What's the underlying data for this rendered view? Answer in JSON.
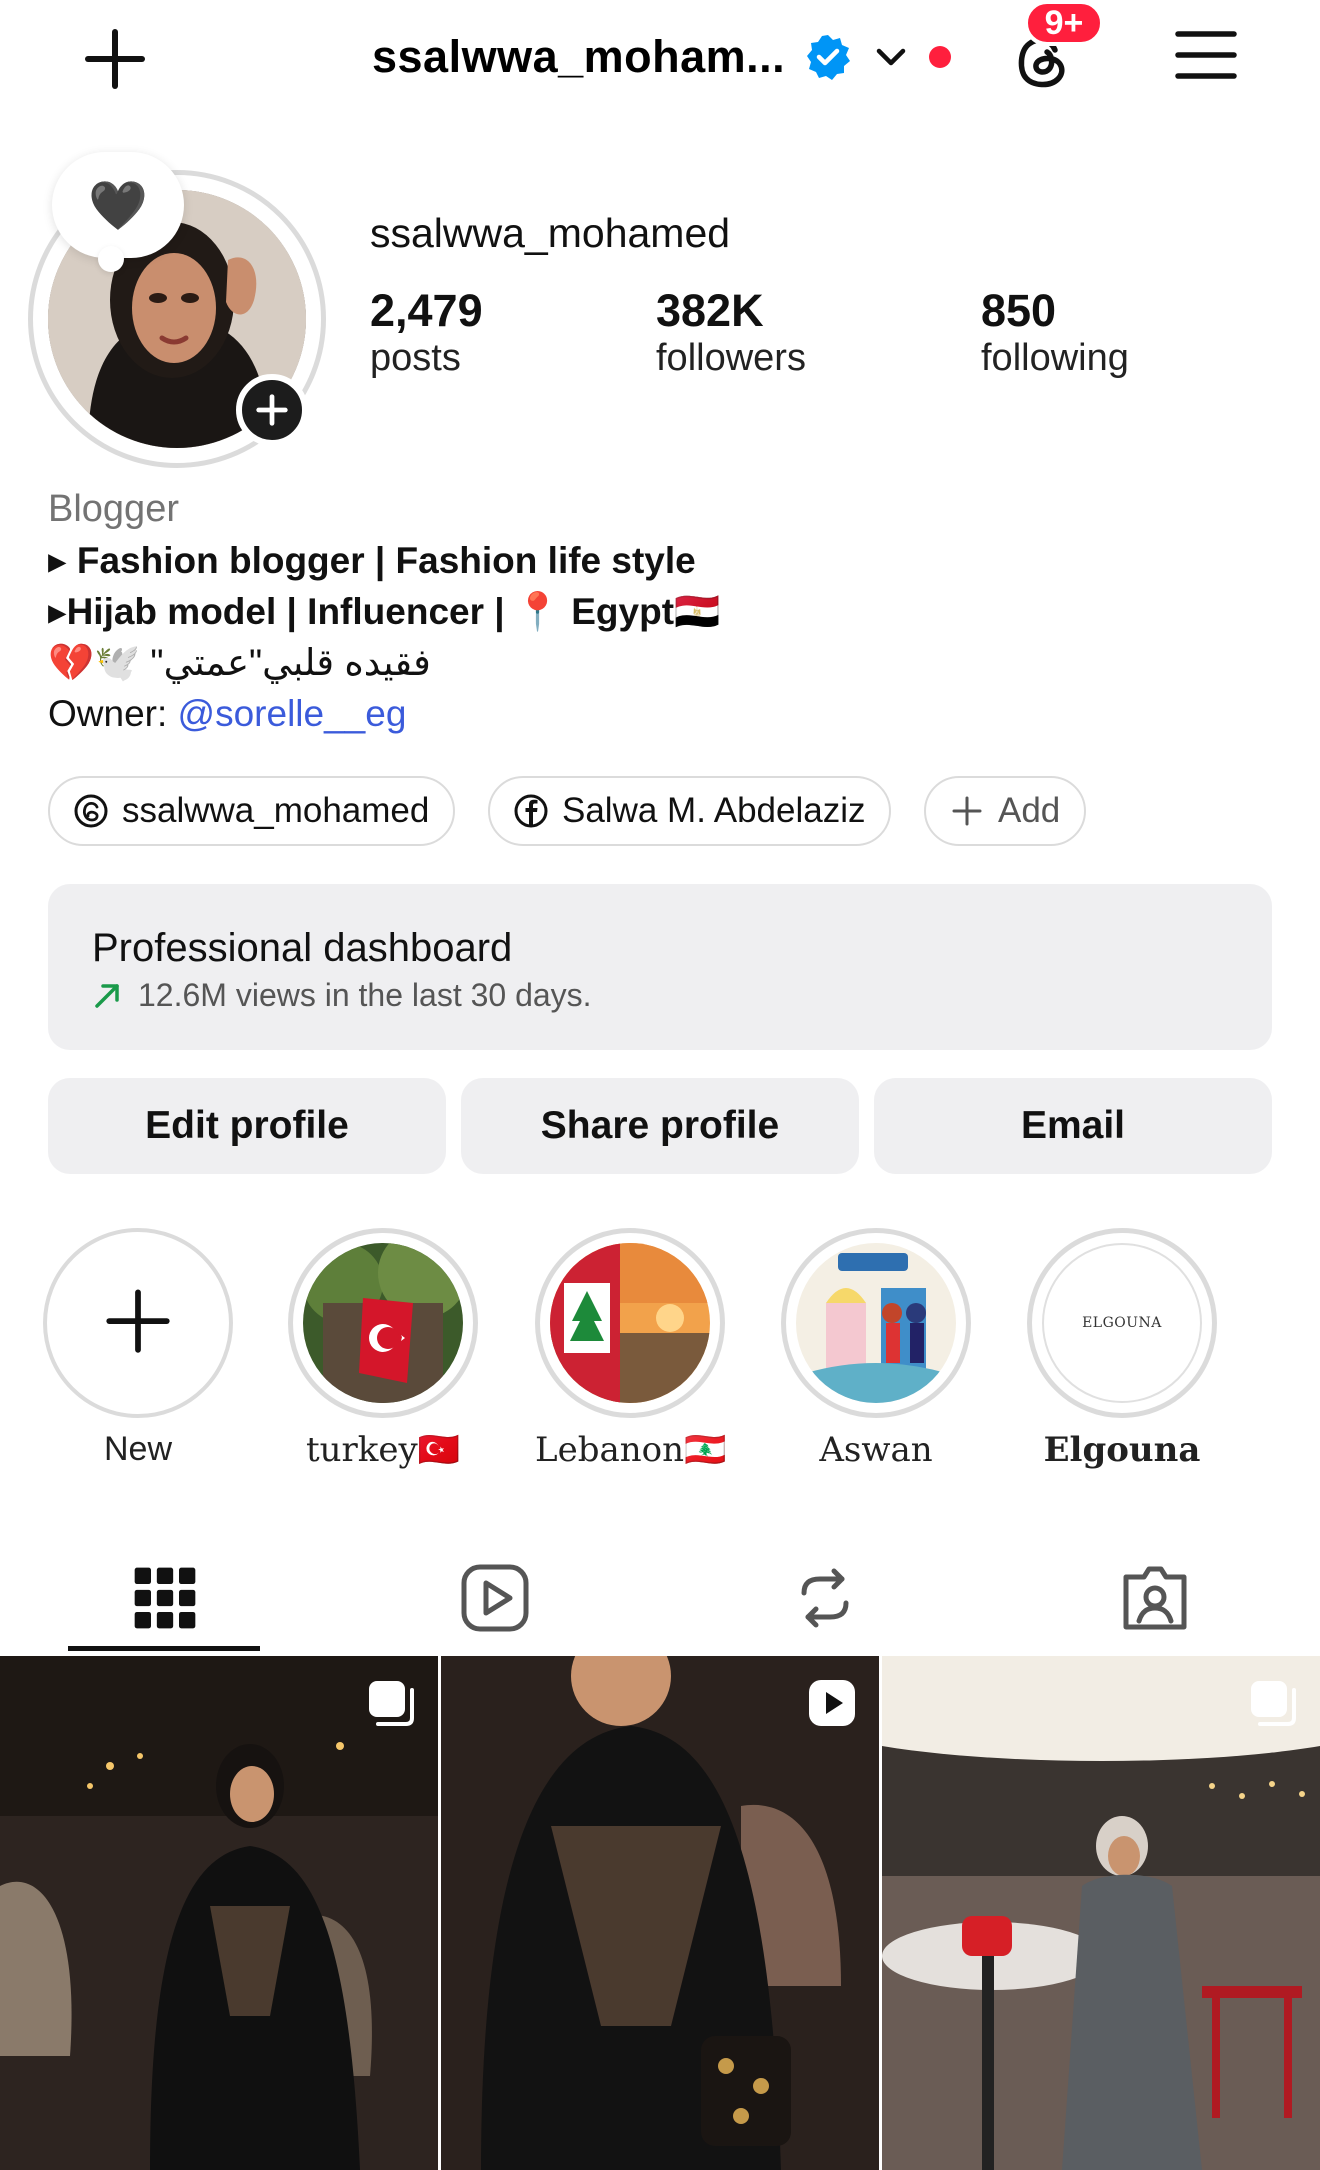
{
  "header": {
    "username_truncated": "ssalwwa_moham...",
    "notification_badge": "9+"
  },
  "profile": {
    "username": "ssalwwa_mohamed",
    "note_emoji": "🖤",
    "stats": [
      {
        "value": "2,479",
        "label": "posts"
      },
      {
        "value": "382K",
        "label": "followers"
      },
      {
        "value": "850",
        "label": "following"
      }
    ],
    "bio": {
      "category": "Blogger",
      "line1": "▸ Fashion blogger | Fashion life style",
      "line2": "▸Hijab model | Influencer | 📍 Egypt🇪🇬",
      "line3": "💔🕊️ \"فقيده قلبي\"عمتي",
      "owner_prefix": "Owner: ",
      "owner_link": "@sorelle__eg"
    },
    "links": [
      {
        "label": "ssalwwa_mohamed",
        "icon": "threads-icon"
      },
      {
        "label": "Salwa M. Abdelaziz",
        "icon": "facebook-icon"
      },
      {
        "label": "Add",
        "icon": "plus-icon"
      }
    ]
  },
  "dashboard": {
    "title": "Professional dashboard",
    "subtitle": "12.6M views in the last 30 days."
  },
  "actions": {
    "edit": "Edit profile",
    "share": "Share profile",
    "email": "Email"
  },
  "highlights": [
    {
      "label": "New"
    },
    {
      "label": "turkey🇹🇷"
    },
    {
      "label": "Lebanon🇱🇧"
    },
    {
      "label": "Aswan"
    },
    {
      "label": "Elgouna",
      "cover_text": "ELGOUNA"
    }
  ],
  "tabs": [
    "grid-icon",
    "reels-icon",
    "reposts-icon",
    "tagged-icon"
  ],
  "colors": {
    "accent_link": "#3b5bdb",
    "notification_red": "#ff1f3d",
    "verified_blue": "#0095f6",
    "button_bg": "#efeff1"
  }
}
